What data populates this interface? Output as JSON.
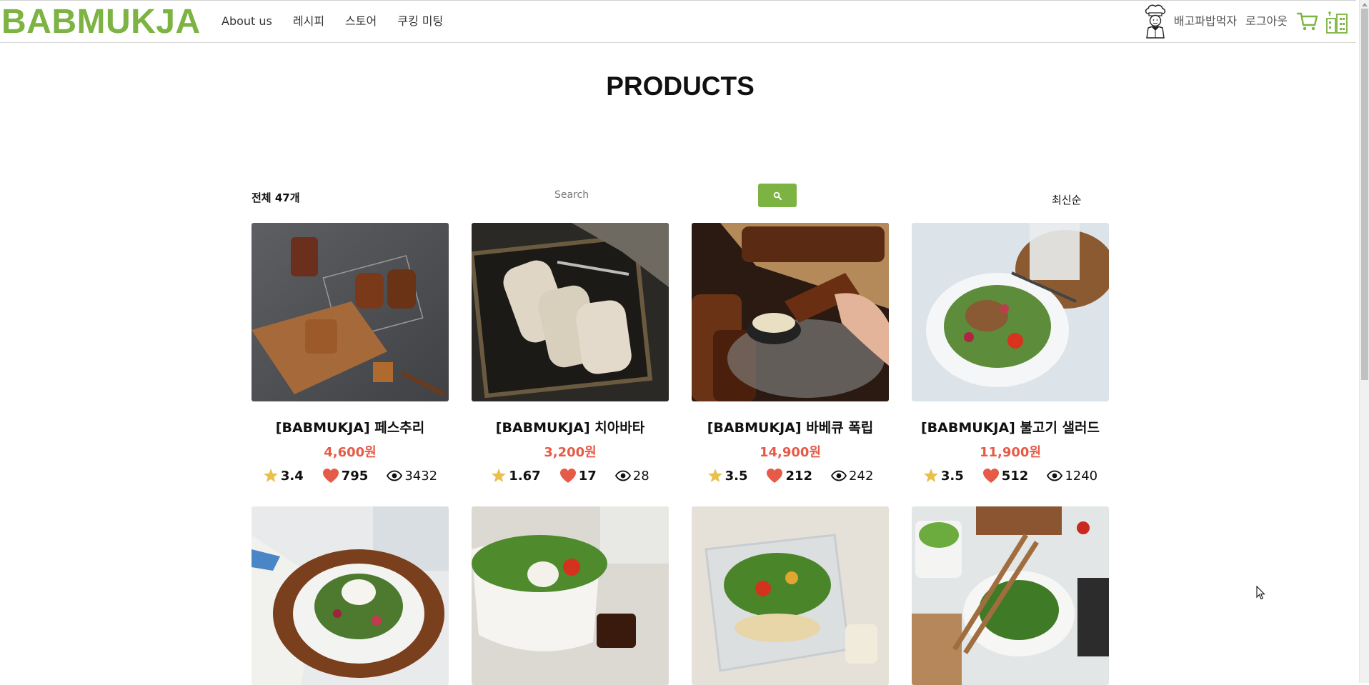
{
  "brand": {
    "logo": "BABMUKJA",
    "accent": "#7cb342",
    "price_color": "#e65a48"
  },
  "nav": {
    "items": [
      "About us",
      "레시피",
      "스토어",
      "쿠킹 미팅"
    ]
  },
  "user": {
    "name": "배고파밥먹자",
    "logout": "로그아웃"
  },
  "page": {
    "title": "PRODUCTS"
  },
  "controls": {
    "count": "전체 47개",
    "search_placeholder": "Search",
    "sort": "최신순"
  },
  "products": [
    {
      "name": "[BABMUKJA] 페스추리",
      "price": "4,600원",
      "rating": "3.4",
      "likes": "795",
      "views": "3432",
      "image": "pastry-photo"
    },
    {
      "name": "[BABMUKJA] 치아바타",
      "price": "3,200원",
      "rating": "1.67",
      "likes": "17",
      "views": "28",
      "image": "ciabatta-photo"
    },
    {
      "name": "[BABMUKJA] 바베큐 폭립",
      "price": "14,900원",
      "rating": "3.5",
      "likes": "212",
      "views": "242",
      "image": "bbq-ribs-photo"
    },
    {
      "name": "[BABMUKJA] 불고기 샐러드",
      "price": "11,900원",
      "rating": "3.5",
      "likes": "512",
      "views": "1240",
      "image": "bulgogi-salad-photo"
    },
    {
      "image": "salad-plate-photo"
    },
    {
      "image": "salad-bowl-photo"
    },
    {
      "image": "salad-container-photo"
    },
    {
      "image": "salad-tongs-photo"
    }
  ]
}
